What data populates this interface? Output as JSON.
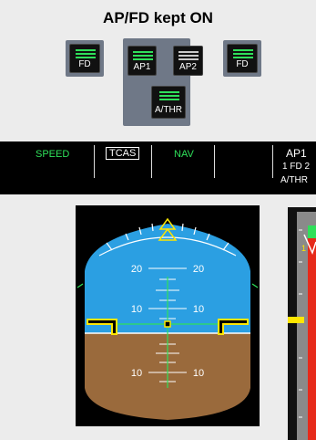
{
  "title": "AP/FD kept ON",
  "fcu": {
    "fd_left": "FD",
    "ap1": "AP1",
    "ap2": "AP2",
    "fd_right": "FD",
    "athr": "A/THR"
  },
  "fma": {
    "speed": "SPEED",
    "tcas": "TCAS",
    "nav": "NAV",
    "ap1": "AP1",
    "fd": "1 FD 2",
    "athr": "A/THR"
  },
  "pfd": {
    "pitch_up_20": "20",
    "pitch_up_10": "10",
    "pitch_down_10": "10"
  },
  "speed_tape": {
    "marker": "1"
  },
  "colors": {
    "sky": "#2b9fe2",
    "ground": "#9a6a3c",
    "fd_green": "#2fe05a",
    "speed_red": "#e62a1a",
    "speed_yellow": "#ffe600"
  }
}
